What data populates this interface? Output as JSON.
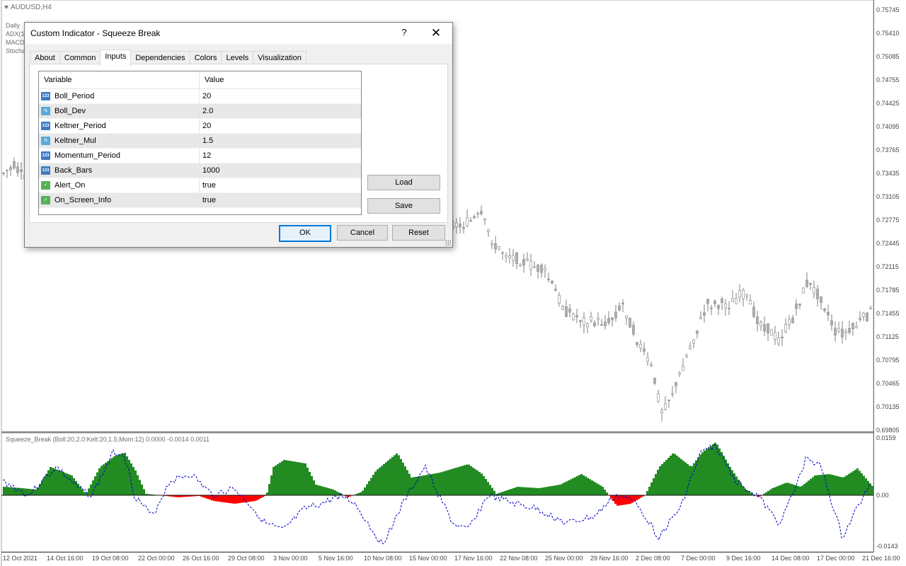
{
  "chart": {
    "symbol": "AUDUSD,H4",
    "indicators": [
      "Daily",
      "ADX(1",
      "MACD",
      "Stocha"
    ],
    "subwindow_label": "Squeeze_Break (Boll:20,2.0:Kelt:20,1.5;Mom:12) 0.0000 -0.0014 0.0011",
    "price_axis": [
      "0.75745",
      "0.75410",
      "0.75085",
      "0.74755",
      "0.74425",
      "0.74095",
      "0.73765",
      "0.73435",
      "0.73105",
      "0.72775",
      "0.72445",
      "0.72115",
      "0.71785",
      "0.71455",
      "0.71125",
      "0.70795",
      "0.70465",
      "0.70135",
      "0.69805"
    ],
    "sub_axis": [
      "0.0159",
      "0.00",
      "-0.0143"
    ],
    "date_axis": [
      "12 Oct 2021",
      "14 Oct 16:00",
      "19 Oct 08:00",
      "22 Oct 00:00",
      "26 Oct 16:00",
      "29 Oct 08:00",
      "3 Nov 00:00",
      "5 Nov 16:00",
      "10 Nov 08:00",
      "15 Nov 00:00",
      "17 Nov 16:00",
      "22 Nov 08:00",
      "25 Nov 00:00",
      "29 Nov 16:00",
      "2 Dec 08:00",
      "7 Dec 00:00",
      "9 Dec 16:00",
      "14 Dec 08:00",
      "17 Dec 00:00",
      "21 Dec 16:00"
    ],
    "colors": {
      "bull_hist": "#228b22",
      "bear_hist": "#ff0000",
      "momentum_line": "#0000cd",
      "candle": "#808080"
    }
  },
  "dialog": {
    "title": "Custom Indicator - Squeeze Break",
    "help": "?",
    "close": "✕",
    "tabs": [
      "About",
      "Common",
      "Inputs",
      "Dependencies",
      "Colors",
      "Levels",
      "Visualization"
    ],
    "active_tab": "Inputs",
    "columns": {
      "variable": "Variable",
      "value": "Value"
    },
    "params": [
      {
        "icon": "int",
        "icon_text": "123",
        "name": "Boll_Period",
        "value": "20"
      },
      {
        "icon": "dbl",
        "icon_text": "½",
        "name": "Boll_Dev",
        "value": "2.0"
      },
      {
        "icon": "int",
        "icon_text": "123",
        "name": "Keltner_Period",
        "value": "20"
      },
      {
        "icon": "dbl",
        "icon_text": "½",
        "name": "Keltner_Mul",
        "value": "1.5"
      },
      {
        "icon": "int",
        "icon_text": "123",
        "name": "Momentum_Period",
        "value": "12"
      },
      {
        "icon": "int",
        "icon_text": "123",
        "name": "Back_Bars",
        "value": "1000"
      },
      {
        "icon": "bool",
        "icon_text": "✓",
        "name": "Alert_On",
        "value": "true"
      },
      {
        "icon": "bool",
        "icon_text": "✓",
        "name": "On_Screen_Info",
        "value": "true"
      }
    ],
    "buttons": {
      "load": "Load",
      "save": "Save",
      "ok": "OK",
      "cancel": "Cancel",
      "reset": "Reset"
    }
  }
}
